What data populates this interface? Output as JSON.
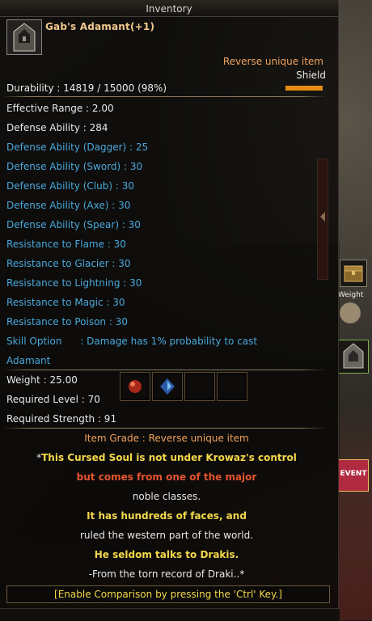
{
  "window": {
    "title": "Inventory"
  },
  "item": {
    "name": "Gab's Adamant(+1)",
    "grade_label": "Reverse unique item",
    "type": "Shield",
    "durability": "Durability : 14819 / 15000 (98%)"
  },
  "stats": [
    {
      "text": "Effective Range : 2.00",
      "color": "white"
    },
    {
      "text": "Defense Ability : 284",
      "color": "white"
    },
    {
      "text": "Defense Ability (Dagger) : 25",
      "color": "blue"
    },
    {
      "text": "Defense Ability (Sword) : 30",
      "color": "blue"
    },
    {
      "text": "Defense Ability (Club) : 30",
      "color": "blue"
    },
    {
      "text": "Defense Ability (Axe) : 30",
      "color": "blue"
    },
    {
      "text": "Defense Ability (Spear) : 30",
      "color": "blue"
    },
    {
      "text": "Resistance to Flame : 30",
      "color": "blue"
    },
    {
      "text": "Resistance to Glacier : 30",
      "color": "blue"
    },
    {
      "text": "Resistance to Lightning : 30",
      "color": "blue"
    },
    {
      "text": "Resistance to Magic : 30",
      "color": "blue"
    },
    {
      "text": "Resistance to Poison : 30",
      "color": "blue"
    },
    {
      "text": "Skill Option      : Damage has 1% probability to cast",
      "color": "blue"
    },
    {
      "text": "Adamant",
      "color": "blue"
    }
  ],
  "requirements": {
    "weight": "Weight : 25.00",
    "level": "Required Level : 70",
    "strength": "Required Strength : 91"
  },
  "lore": {
    "grade": "Item Grade : Reverse unique item",
    "lines": [
      {
        "text": "*",
        "color": "white"
      },
      {
        "text": "This Cursed Soul is not under Krowaz's control",
        "color": "yellow"
      },
      {
        "text": "but comes from one of the major",
        "color": "red"
      },
      {
        "text": "noble classes.",
        "color": "white"
      },
      {
        "text": "It has hundreds of faces, and",
        "color": "yellow"
      },
      {
        "text": "ruled the western part of the world.",
        "color": "white"
      },
      {
        "text": "He seldom talks to Drakis.",
        "color": "yellow"
      },
      {
        "text": "-From the torn record of Draki..*",
        "color": "white"
      }
    ]
  },
  "footer": {
    "compare_hint": "[Enable Comparison by pressing the 'Ctrl' Key.]"
  },
  "side_ui": {
    "weight_label": "Weight",
    "event_label": "EVENT"
  },
  "colors": {
    "white": "#e8e8e8",
    "blue": "#4aa8dc",
    "yellow": "#f4d84a",
    "orange": "#f0a15b",
    "red": "#e5542e",
    "accent_bar": "#e88a13"
  }
}
